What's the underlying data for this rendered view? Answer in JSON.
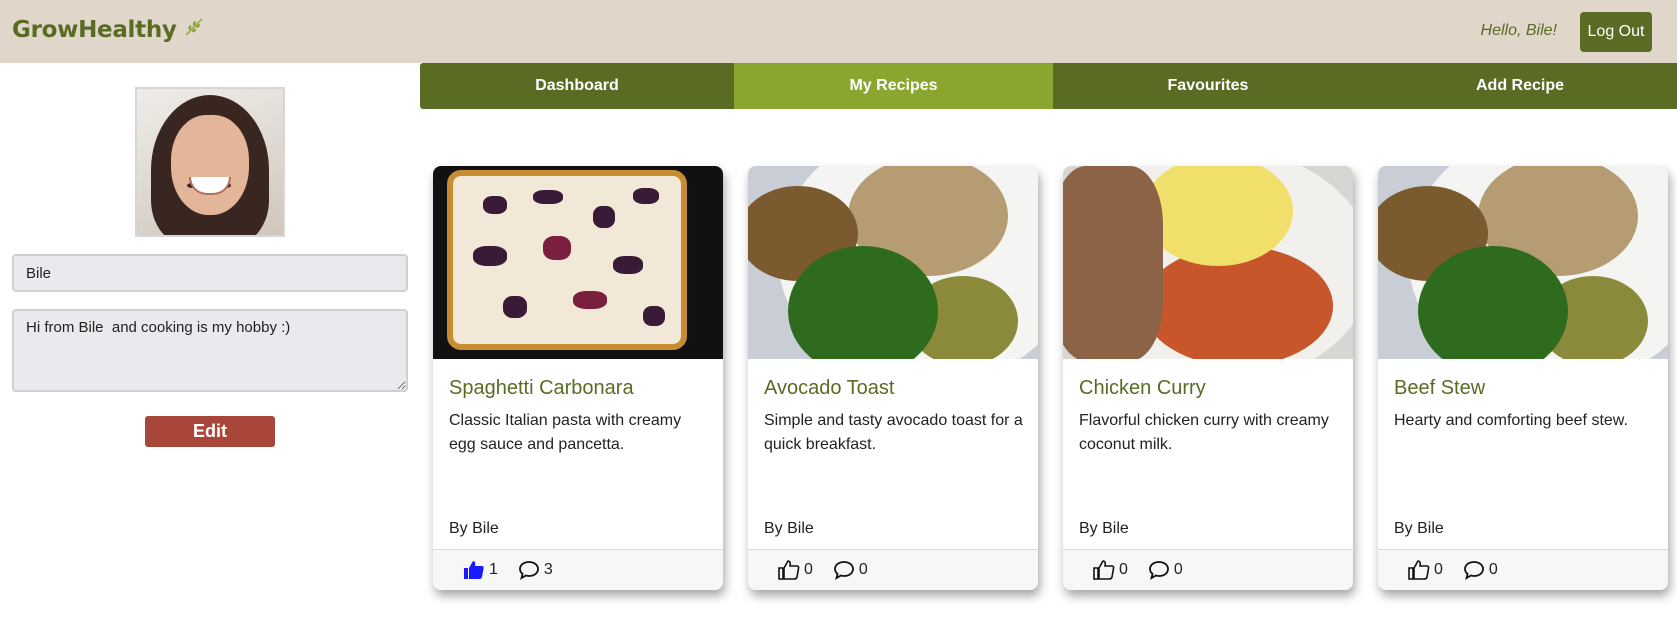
{
  "header": {
    "brand": "GrowHealthy",
    "brand_icon": "leaf-icon",
    "greeting": "Hello, Bile!",
    "logout_label": "Log Out"
  },
  "nav": {
    "tabs": [
      {
        "label": "Dashboard",
        "active": false
      },
      {
        "label": "My Recipes",
        "active": true
      },
      {
        "label": "Favourites",
        "active": false
      },
      {
        "label": "Add Recipe",
        "active": false
      }
    ]
  },
  "profile": {
    "name_value": "Bile",
    "bio_value": "Hi from Bile  and cooking is my hobby :)",
    "edit_label": "Edit"
  },
  "recipes": [
    {
      "title": "Spaghetti Carbonara",
      "description": "Classic Italian pasta with creamy egg sauce and pancetta.",
      "author": "By Bile",
      "likes": "1",
      "comments": "3",
      "liked": true
    },
    {
      "title": "Avocado Toast",
      "description": "Simple and tasty avocado toast for a quick breakfast.",
      "author": "By Bile",
      "likes": "0",
      "comments": "0",
      "liked": false
    },
    {
      "title": "Chicken Curry",
      "description": "Flavorful chicken curry with creamy coconut milk.",
      "author": "By Bile",
      "likes": "0",
      "comments": "0",
      "liked": false
    },
    {
      "title": "Beef Stew",
      "description": "Hearty and comforting beef stew.",
      "author": "By Bile",
      "likes": "0",
      "comments": "0",
      "liked": false
    }
  ],
  "colors": {
    "brand_green": "#5a6b24",
    "active_tab": "#8aa62f",
    "header_bg": "#e0d6ca",
    "edit_red": "#a8463a",
    "like_blue": "#1a1aff"
  }
}
